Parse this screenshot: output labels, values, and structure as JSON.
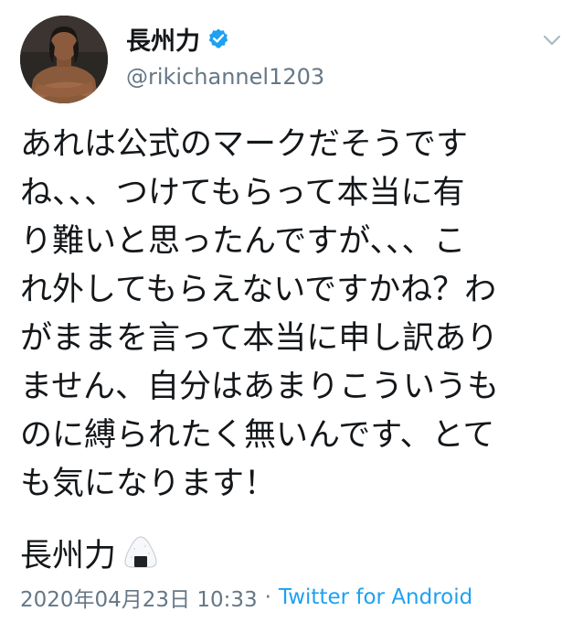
{
  "colors": {
    "text_primary": "#14171a",
    "text_secondary": "#657786",
    "link": "#1da1f2",
    "verified_badge": "#1da1f2"
  },
  "author": {
    "display_name": "長州力",
    "handle": "@rikichannel1203",
    "verified": true,
    "verified_icon": "verified-badge-icon",
    "avatar_icon": "profile-photo"
  },
  "menu": {
    "icon": "chevron-down-icon"
  },
  "tweet": {
    "lines": [
      "あれは公式のマークだそうです",
      "ね、、、つけてもらって本当に有",
      "り難いと思ったんですが、、、こ",
      "れ外してもらえないですかね？わ",
      "がままを言って本当に申し訳あり",
      "ません、自分はあまりこういうも",
      "のに縛られたく無いんです、とて",
      "も気になります！"
    ],
    "signature": "長州力",
    "signature_emoji": "onigiri-icon"
  },
  "meta": {
    "timestamp": "2020年04月23日 10:33",
    "separator": "·",
    "source": "Twitter for Android"
  }
}
